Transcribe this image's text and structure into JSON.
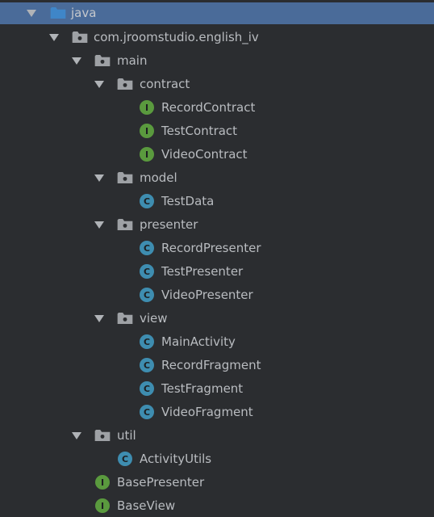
{
  "tree": [
    {
      "label": "java",
      "kind": "folder",
      "expanded": true,
      "selected": true
    },
    {
      "label": "com.jroomstudio.english_iv",
      "kind": "package",
      "expanded": true
    },
    {
      "label": "main",
      "kind": "package",
      "expanded": true
    },
    {
      "label": "contract",
      "kind": "package",
      "expanded": true
    },
    {
      "label": "RecordContract",
      "kind": "interface",
      "badge": "I"
    },
    {
      "label": "TestContract",
      "kind": "interface",
      "badge": "I"
    },
    {
      "label": "VideoContract",
      "kind": "interface",
      "badge": "I"
    },
    {
      "label": "model",
      "kind": "package",
      "expanded": true
    },
    {
      "label": "TestData",
      "kind": "class",
      "badge": "C"
    },
    {
      "label": "presenter",
      "kind": "package",
      "expanded": true
    },
    {
      "label": "RecordPresenter",
      "kind": "class",
      "badge": "C"
    },
    {
      "label": "TestPresenter",
      "kind": "class",
      "badge": "C"
    },
    {
      "label": "VideoPresenter",
      "kind": "class",
      "badge": "C"
    },
    {
      "label": "view",
      "kind": "package",
      "expanded": true
    },
    {
      "label": "MainActivity",
      "kind": "class",
      "badge": "C"
    },
    {
      "label": "RecordFragment",
      "kind": "class",
      "badge": "C"
    },
    {
      "label": "TestFragment",
      "kind": "class",
      "badge": "C"
    },
    {
      "label": "VideoFragment",
      "kind": "class",
      "badge": "C"
    },
    {
      "label": "util",
      "kind": "package",
      "expanded": true
    },
    {
      "label": "ActivityUtils",
      "kind": "class",
      "badge": "C"
    },
    {
      "label": "BasePresenter",
      "kind": "interface",
      "badge": "I"
    },
    {
      "label": "BaseView",
      "kind": "interface",
      "badge": "I"
    }
  ],
  "colors": {
    "background": "#2b2d30",
    "selection": "#4a6b99",
    "folder_blue": "#3f86c8",
    "package_gray": "#9ea1a5",
    "interface_green": "#5a9a3e",
    "class_blue": "#3e8db0",
    "text": "#b9bcc0"
  }
}
